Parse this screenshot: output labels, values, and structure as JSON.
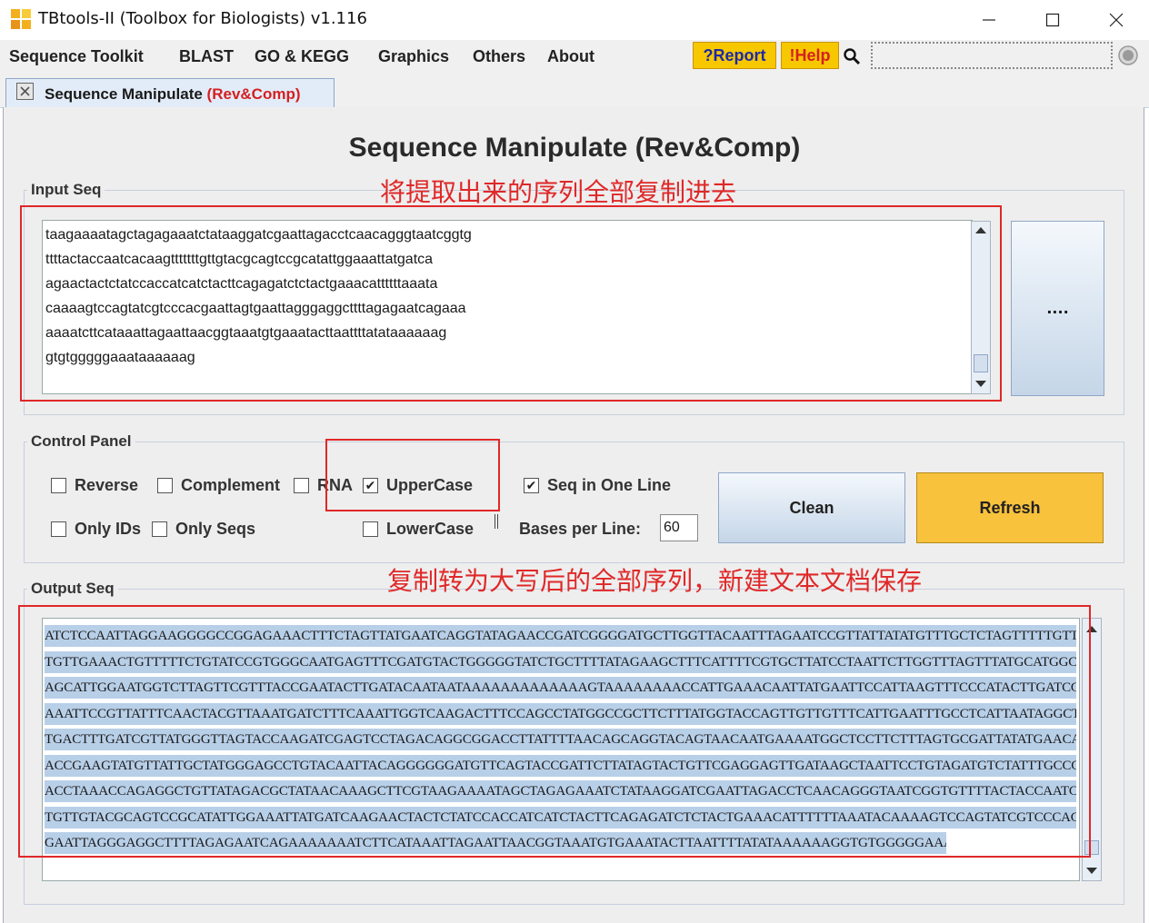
{
  "window": {
    "title": "TBtools-II (Toolbox for Biologists) v1.116",
    "controls": [
      "minimize",
      "maximize",
      "close"
    ]
  },
  "menu": {
    "items": [
      "Sequence Toolkit",
      "BLAST",
      "GO & KEGG",
      "Graphics",
      "Others",
      "About"
    ],
    "report_label": "?Report",
    "help_label": "!Help",
    "search_value": ""
  },
  "tab": {
    "label": "Sequence Manipulate ",
    "label_suffix": "(Rev&Comp)"
  },
  "page_title": "Sequence Manipulate (Rev&Comp)",
  "input": {
    "group_label": "Input Seq",
    "annotation": "将提取出来的序列全部复制进去",
    "lines": [
      "taagaaaatagctagagaaatctataaggatcgaattagacctcaacagggtaatcggtg",
      "ttttactaccaatcacaagtttttttgttgtacgcagtccgcatattggaaattatgatca",
      "agaactactctatccaccatcatctacttcagagatctctactgaaacattttttaaata",
      "caaaagtccagtatcgtcccacgaattagtgaattagggaggcttttagagaatcagaaa",
      "aaaatcttcataaattagaattaacggtaaatgtgaaatacttaattttatataaaaaag",
      "gtgtgggggaaataaaaaag"
    ],
    "browse_label": "...."
  },
  "control": {
    "group_label": "Control Panel",
    "reverse": {
      "label": "Reverse",
      "checked": false
    },
    "complement": {
      "label": "Complement",
      "checked": false
    },
    "rna": {
      "label": "RNA",
      "checked": false
    },
    "uppercase": {
      "label": "UpperCase",
      "checked": true
    },
    "lowercase": {
      "label": "LowerCase",
      "checked": false
    },
    "seq_one_line": {
      "label": "Seq in One Line",
      "checked": true
    },
    "only_ids": {
      "label": "Only IDs",
      "checked": false
    },
    "only_seqs": {
      "label": "Only Seqs",
      "checked": false
    },
    "bases_per_line_label": "Bases per Line:",
    "bases_per_line_value": "60",
    "clean_label": "Clean",
    "refresh_label": "Refresh"
  },
  "output": {
    "group_label": "Output Seq",
    "annotation": "复制转为大写后的全部序列，新建文本文档保存",
    "lines": [
      "ATCTCCAATTAGGAAGGGGCCGGAGAAACTTTCTAGTTATGAATCAGGTATAGAACCGATCGGGGATGCTTGGTTACAATTTAGAATCCGTTATTATATGTTTGCTCTAGTTTTTGTTGTTTTTGA",
      "TGTTGAAACTGTTTTTCTGTATCCGTGGGCAATGAGTTTCGATGTACTGGGGGTATCTGCTTTTATAGAAGCTTTCATTTTCGTGCTTATCCTAATTCTTGGTTTAGTTTATGCATGGCGAAAAGG",
      "AGCATTGGAATGGTCTTAGTTCGTTTACCGAATACTTGATACAATAATAAAAAAAAAAAAAGTAAAAAAAACCATTGAAACAATTATGAATTCCATTAAGTTTCCCATACTTGATCGAACAACAAA",
      "AAATTCCGTTATTTCAACTACGTTAAATGATCTTTCAAATTGGTCAAGACTTTCCAGCCTATGGCCGCTTCTTTATGGTACCAGTTGTTGTTTCATTGAATTTGCCTCATTAATAGGCTCCCGATT",
      "TGACTTTGATCGTTATGGGTTAGTACCAAGATCGAGTCCTAGACAGGCGGACCTTATTTTAACAGCAGGTACAGTAACAATGAAAATGGCTCCTTCTTTAGTGCGATTATATGAACAAATGCCTGA",
      "ACCGAAGTATGTTATTGCTATGGGAGCCTGTACAATTACAGGGGGGATGTTCAGTACCGATTCTTATAGTACTGTTCGAGGAGTTGATAAGCTAATTCCTGTAGATGTCTATTTGCCGGGTTGTCC",
      "ACCTAAACCAGAGGCTGTTATAGACGCTATAACAAAGCTTCGTAAGAAAATAGCTAGAGAAATCTATAAGGATCGAATTAGACCTCAACAGGGTAATCGGTGTTTTACTACCAATCACAAGTTTTT",
      "TGTTGTACGCAGTCCGCATATTGGAAATTATGATCAAGAACTACTCTATCCACCATCATCTACTTCAGAGATCTCTACTGAAACATTTTTTAAATACAAAAGTCCAGTATCGTCCCACGAATTAGT",
      "GAATTAGGGAGGCTTTTAGAGAATCAGAAAAAAATCTTCATAAATTAGAATTAACGGTAAATGTGAAATACTTAATTTTATATAAAAAAGGTGTGGGGGAAATAAAAAAG"
    ]
  },
  "colors": {
    "annotation_red": "#e02828",
    "help_yellow": "#f7c700",
    "refresh_yellow": "#f9c23c",
    "selection_blue": "#b8cfe8"
  }
}
